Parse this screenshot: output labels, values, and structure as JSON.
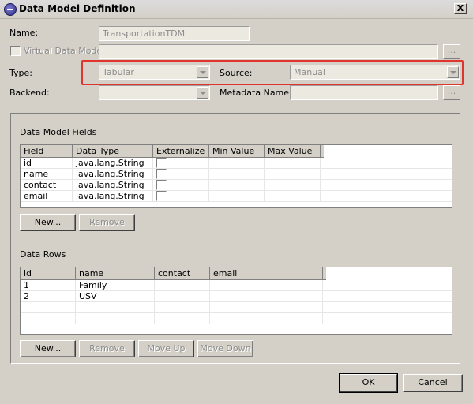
{
  "window": {
    "title": "Data Model Definition",
    "close_glyph": "X"
  },
  "form": {
    "name_label": "Name:",
    "name_value": "TransportationTDM",
    "virtual_label": "Virtual Data Model",
    "browse_glyph": "...",
    "type_label": "Type:",
    "type_value": "Tabular",
    "source_label": "Source:",
    "source_value": "Manual",
    "backend_label": "Backend:",
    "backend_value": "",
    "metadata_label": "Metadata Name:",
    "metadata_value": ""
  },
  "fields": {
    "section_label": "Data Model Fields",
    "columns": [
      "Field",
      "Data Type",
      "Externalize",
      "Min Value",
      "Max Value"
    ],
    "rows": [
      {
        "field": "id",
        "type": "java.lang.String"
      },
      {
        "field": "name",
        "type": "java.lang.String"
      },
      {
        "field": "contact",
        "type": "java.lang.String"
      },
      {
        "field": "email",
        "type": "java.lang.String"
      }
    ],
    "new_label": "New...",
    "remove_label": "Remove"
  },
  "datarows": {
    "section_label": "Data Rows",
    "columns": [
      "id",
      "name",
      "contact",
      "email"
    ],
    "rows": [
      {
        "id": "1",
        "name": "Family"
      },
      {
        "id": "2",
        "name": "USV"
      }
    ],
    "new_label": "New...",
    "remove_label": "Remove",
    "moveup_label": "Move Up",
    "movedown_label": "Move Down"
  },
  "footer": {
    "ok_label": "OK",
    "cancel_label": "Cancel"
  }
}
